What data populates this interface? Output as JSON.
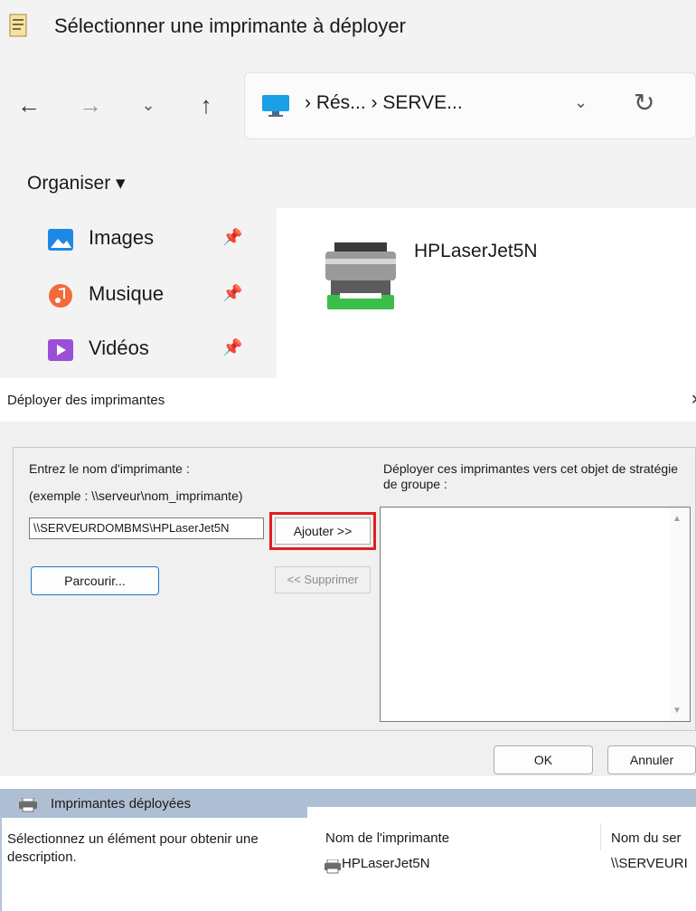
{
  "picker": {
    "title": "Sélectionner une imprimante à déployer",
    "address": {
      "path": "› Rés... › SERVE..."
    },
    "command_bar": {
      "organise_label": "Organiser ▾"
    },
    "nav_items": [
      {
        "label": "Images",
        "icon": "images-icon",
        "color": "#1e88e5"
      },
      {
        "label": "Musique",
        "icon": "music-icon",
        "color": "#f26b3a"
      },
      {
        "label": "Vidéos",
        "icon": "videos-icon",
        "color": "#9b4fd6"
      }
    ],
    "files": [
      {
        "name": "HPLaserJet5N",
        "icon": "printer-icon"
      }
    ]
  },
  "dialog": {
    "title": "Déployer des imprimantes",
    "enter_label": "Entrez le nom d'imprimante :",
    "example_label": "(exemple : \\\\serveur\\nom_imprimante)",
    "printer_input_value": "\\\\SERVEURDOMBMS\\HPLaserJet5N",
    "add_label": "Ajouter >>",
    "browse_label": "Parcourir...",
    "remove_label": "<< Supprimer",
    "deploy_label": "Déployer ces imprimantes vers cet objet de stratégie de groupe :",
    "ok_label": "OK",
    "cancel_label": "Annuler",
    "highlight_color": "#e01f1f"
  },
  "deployed": {
    "title": "Imprimantes déployées",
    "description": "Sélectionnez un élément pour obtenir une description.",
    "columns": [
      "Nom de l'imprimante",
      "Nom du ser"
    ],
    "rows": [
      {
        "name": "HPLaserJet5N",
        "server": "\\\\SERVEURI"
      }
    ]
  }
}
